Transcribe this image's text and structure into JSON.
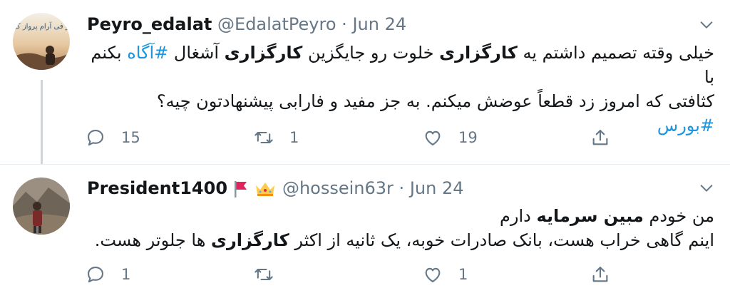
{
  "tweets": [
    {
      "author": "Peyro_edalat",
      "handle": "@EdalatPeyro",
      "separator": "·",
      "date": "Jun 24",
      "avatar_text": "تو فی آرام پرواز کن",
      "body_line1": {
        "p1": "خیلی وقته تصمیم داشتم یه ",
        "b1": "کارگزاری",
        "p2": " خلوت رو جایگزین ",
        "b2": "کارگزاری",
        "p3": " آشغال ",
        "t1": "#آگاه",
        "p4": " بکنم با"
      },
      "body_line2": "کثافتی که امروز زد قطعاً عوضش میکنم. به جز مفید و فارابی پیشنهادتون چیه؟",
      "body_line3_tag": "#بورس",
      "replies": "15",
      "retweets": "1",
      "likes": "19"
    },
    {
      "author": "President1400",
      "handle": "@hossein63r",
      "separator": "·",
      "date": "Jun 24",
      "body_line1": {
        "p1": "من خودم ",
        "b1": "مبین سرمایه",
        "p2": " دارم"
      },
      "body_line2": {
        "p1": "اینم گاهی خراب هست، بانک صادرات خوبه، یک ثانیه از اکثر ",
        "b1": "کارگزاری",
        "p2": " ها جلوتر هست."
      },
      "replies": "1",
      "retweets": "",
      "likes": "1"
    }
  ],
  "icons": {
    "reply": "reply-icon",
    "retweet": "retweet-icon",
    "like": "like-icon",
    "share": "share-icon",
    "more": "chevron-down-icon",
    "flag": "red-flag-emoji",
    "crown": "crown-emoji"
  },
  "colors": {
    "accent": "#1b95e0",
    "muted": "#657786",
    "flag": "#e0245e",
    "crown": "#ffcc4d"
  }
}
